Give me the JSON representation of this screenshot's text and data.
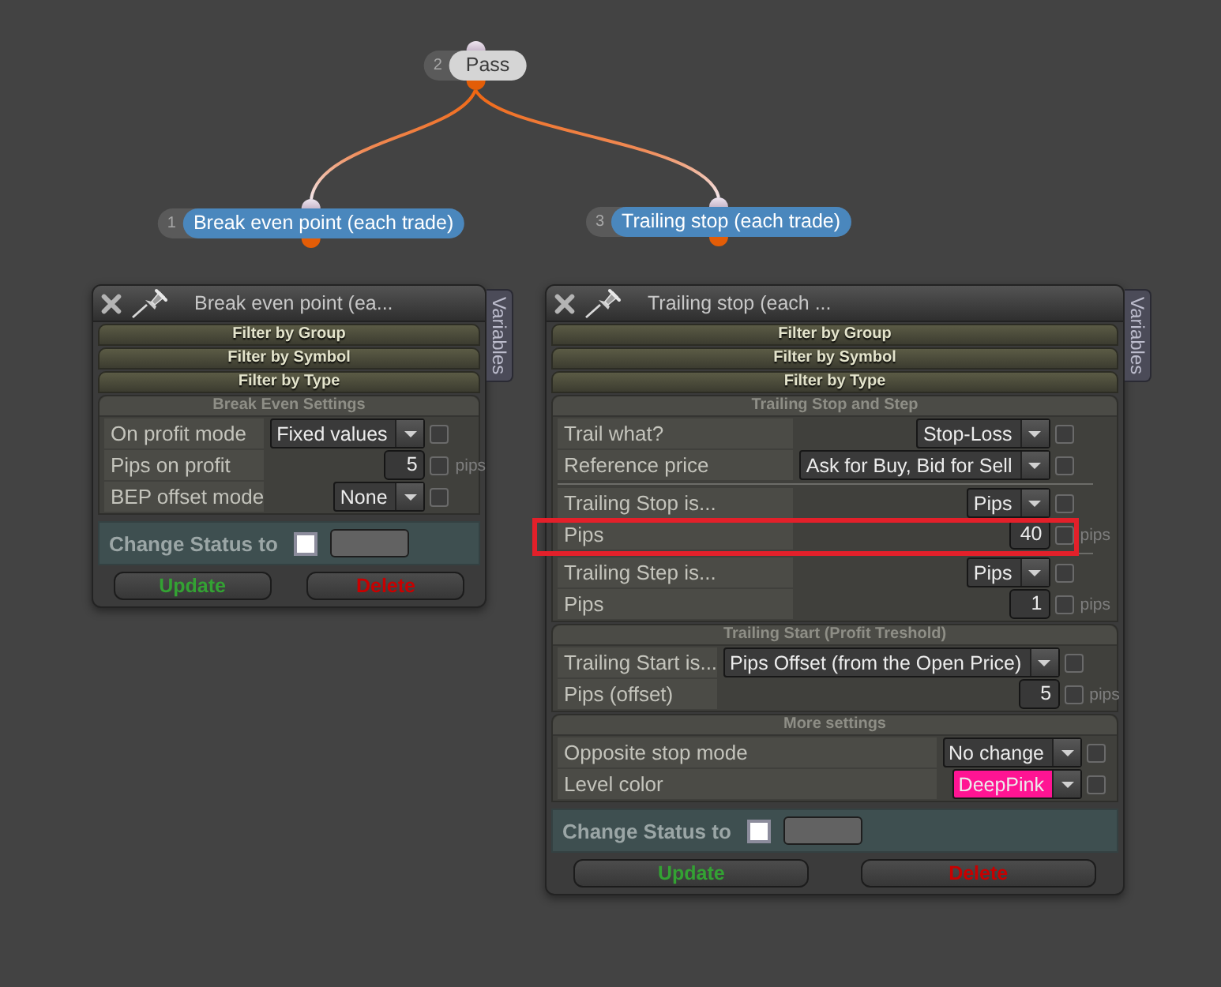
{
  "nodes": [
    {
      "number": "2",
      "label": "Pass",
      "kind": "gate",
      "children": [
        {
          "number": "1",
          "label": "Break even point (each trade)",
          "kind": "action"
        },
        {
          "number": "3",
          "label": "Trailing stop (each trade)",
          "kind": "action"
        }
      ]
    }
  ],
  "panels": [
    {
      "title": "Break even point (ea...",
      "side_tab": "Variables",
      "filters": [
        "Filter by Group",
        "Filter by Symbol",
        "Filter by Type"
      ],
      "sections": [
        {
          "title": "Break Even Settings",
          "groups": [
            {
              "rows": [
                {
                  "kind": "select",
                  "label": "On profit mode",
                  "value": "Fixed values",
                  "checked": false,
                  "highlighted": false
                },
                {
                  "kind": "number",
                  "label": "Pips on profit",
                  "value": "5",
                  "unit": "pips",
                  "checked": false,
                  "highlighted": false
                },
                {
                  "kind": "select",
                  "label": "BEP offset mode",
                  "value": "None",
                  "checked": false,
                  "highlighted": false
                }
              ]
            }
          ]
        }
      ],
      "status": {
        "label": "Change Status to",
        "checked": false
      },
      "buttons": [
        {
          "label": "Update",
          "kind": "update"
        },
        {
          "label": "Delete",
          "kind": "delete"
        }
      ]
    },
    {
      "title": "Trailing stop (each ...",
      "side_tab": "Variables",
      "filters": [
        "Filter by Group",
        "Filter by Symbol",
        "Filter by Type"
      ],
      "sections": [
        {
          "title": "Trailing Stop and Step",
          "groups": [
            {
              "rows": [
                {
                  "kind": "select",
                  "label": "Trail what?",
                  "value": "Stop-Loss",
                  "checked": false,
                  "highlighted": false
                },
                {
                  "kind": "select",
                  "label": "Reference price",
                  "value": "Ask for Buy, Bid for Sell",
                  "checked": false,
                  "highlighted": false
                }
              ]
            },
            {
              "rows": [
                {
                  "kind": "select",
                  "label": "Trailing Stop is...",
                  "value": "Pips",
                  "checked": false,
                  "highlighted": false
                },
                {
                  "kind": "number",
                  "label": "Pips",
                  "value": "40",
                  "unit": "pips",
                  "checked": false,
                  "highlighted": true
                }
              ]
            },
            {
              "rows": [
                {
                  "kind": "select",
                  "label": "Trailing Step is...",
                  "value": "Pips",
                  "checked": false,
                  "highlighted": false
                },
                {
                  "kind": "number",
                  "label": "Pips",
                  "value": "1",
                  "unit": "pips",
                  "checked": false,
                  "highlighted": false
                }
              ]
            }
          ]
        },
        {
          "title": "Trailing Start (Profit Treshold)",
          "groups": [
            {
              "rows": [
                {
                  "kind": "select",
                  "label": "Trailing Start is...",
                  "value": "Pips Offset (from the Open Price)",
                  "checked": false,
                  "highlighted": false
                },
                {
                  "kind": "number",
                  "label": "Pips (offset)",
                  "value": "5",
                  "unit": "pips",
                  "checked": false,
                  "highlighted": false
                }
              ]
            }
          ]
        },
        {
          "title": "More settings",
          "groups": [
            {
              "rows": [
                {
                  "kind": "select",
                  "label": "Opposite stop mode",
                  "value": "No change",
                  "checked": false,
                  "highlighted": false
                },
                {
                  "kind": "select",
                  "label": "Level color",
                  "value": "DeepPink",
                  "color": "#ff1493",
                  "checked": false,
                  "highlighted": false
                }
              ]
            }
          ]
        }
      ],
      "status": {
        "label": "Change Status to",
        "checked": false
      },
      "buttons": [
        {
          "label": "Update",
          "kind": "update"
        },
        {
          "label": "Delete",
          "kind": "delete"
        }
      ]
    }
  ]
}
